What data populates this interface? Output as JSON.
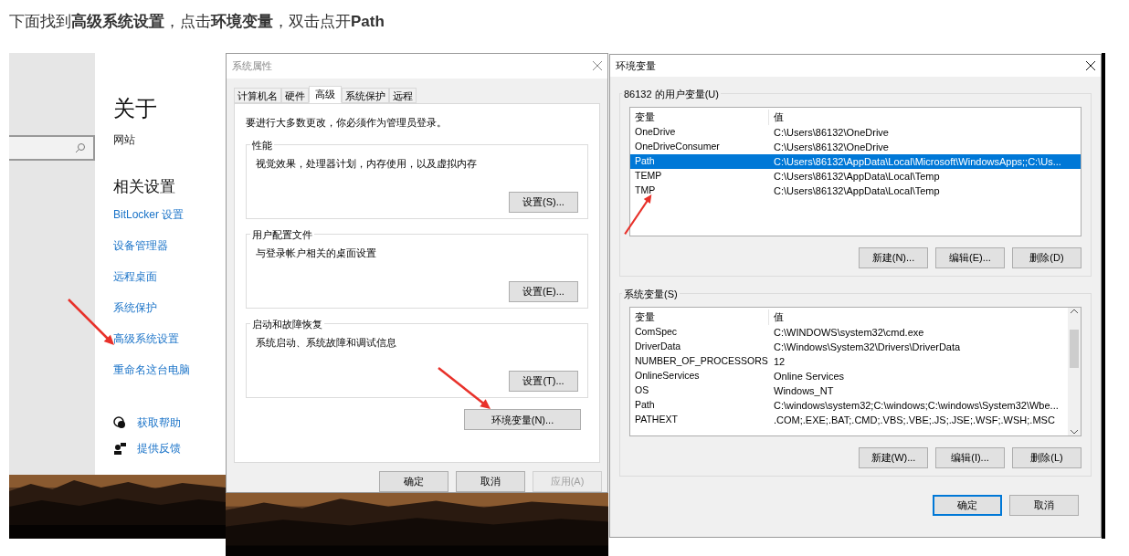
{
  "heading": "下面找到**高级系统设置**，点击**环境变量**，双击点开**Path**",
  "settings": {
    "title": "关于",
    "site_label": "网站",
    "related_title": "相关设置",
    "links": [
      "BitLocker 设置",
      "设备管理器",
      "远程桌面",
      "系统保护",
      "高级系统设置",
      "重命名这台电脑"
    ],
    "help_links": [
      {
        "kind": "help",
        "label": "获取帮助"
      },
      {
        "kind": "feedback",
        "label": "提供反馈"
      }
    ]
  },
  "system_properties": {
    "title": "系统属性",
    "tabs": [
      {
        "label": "计算机名",
        "selected": false
      },
      {
        "label": "硬件",
        "selected": false
      },
      {
        "label": "高级",
        "selected": true
      },
      {
        "label": "系统保护",
        "selected": false
      },
      {
        "label": "远程",
        "selected": false
      }
    ],
    "notice": "要进行大多数更改，你必须作为管理员登录。",
    "groups": [
      {
        "title": "性能",
        "text": "视觉效果，处理器计划，内存使用，以及虚拟内存",
        "button": "设置(S)..."
      },
      {
        "title": "用户配置文件",
        "text": "与登录帐户相关的桌面设置",
        "button": "设置(E)..."
      },
      {
        "title": "启动和故障恢复",
        "text": "系统启动、系统故障和调试信息",
        "button": "设置(T)..."
      }
    ],
    "env_button": "环境变量(N)...",
    "footer": [
      {
        "label": "确定",
        "disabled": false
      },
      {
        "label": "取消",
        "disabled": false
      },
      {
        "label": "应用(A)",
        "disabled": true
      }
    ]
  },
  "environment_variables": {
    "title": "环境变量",
    "sections": [
      {
        "title": "86132 的用户变量(U)",
        "columns": [
          "变量",
          "值"
        ],
        "scrollable": false,
        "rows": [
          {
            "name": "OneDrive",
            "value": "C:\\Users\\86132\\OneDrive",
            "selected": false
          },
          {
            "name": "OneDriveConsumer",
            "value": "C:\\Users\\86132\\OneDrive",
            "selected": false
          },
          {
            "name": "Path",
            "value": "C:\\Users\\86132\\AppData\\Local\\Microsoft\\WindowsApps;;C:\\Us...",
            "selected": true
          },
          {
            "name": "TEMP",
            "value": "C:\\Users\\86132\\AppData\\Local\\Temp",
            "selected": false
          },
          {
            "name": "TMP",
            "value": "C:\\Users\\86132\\AppData\\Local\\Temp",
            "selected": false
          }
        ],
        "buttons": [
          "新建(N)...",
          "编辑(E)...",
          "删除(D)"
        ]
      },
      {
        "title": "系统变量(S)",
        "columns": [
          "变量",
          "值"
        ],
        "scrollable": true,
        "rows": [
          {
            "name": "ComSpec",
            "value": "C:\\WINDOWS\\system32\\cmd.exe",
            "selected": false
          },
          {
            "name": "DriverData",
            "value": "C:\\Windows\\System32\\Drivers\\DriverData",
            "selected": false
          },
          {
            "name": "NUMBER_OF_PROCESSORS",
            "value": "12",
            "selected": false
          },
          {
            "name": "OnlineServices",
            "value": "Online Services",
            "selected": false
          },
          {
            "name": "OS",
            "value": "Windows_NT",
            "selected": false
          },
          {
            "name": "Path",
            "value": "C:\\windows\\system32;C:\\windows;C:\\windows\\System32\\Wbe...",
            "selected": false
          },
          {
            "name": "PATHEXT",
            "value": ".COM;.EXE;.BAT;.CMD;.VBS;.VBE;.JS;.JSE;.WSF;.WSH;.MSC",
            "selected": false
          }
        ],
        "buttons": [
          "新建(W)...",
          "编辑(I)...",
          "删除(L)"
        ]
      }
    ],
    "footer": [
      {
        "label": "确定",
        "default": true
      },
      {
        "label": "取消",
        "default": false
      }
    ]
  }
}
